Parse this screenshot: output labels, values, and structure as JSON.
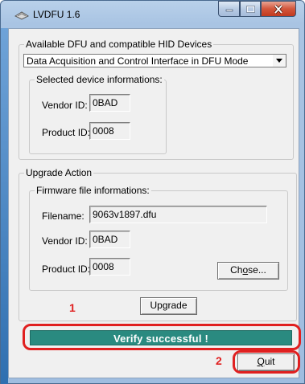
{
  "window": {
    "title": "LVDFU 1.6",
    "icon": "lvdfu-app-icon",
    "controls": {
      "minimize": "minimize-icon",
      "maximize": "maximize-icon",
      "close": "close-icon"
    }
  },
  "devices": {
    "legend": "Available DFU and compatible HID Devices",
    "selected": "Data Acquisition and Control Interface in DFU Mode",
    "dropdown_icon": "chevron-down-icon",
    "info": {
      "legend": "Selected device informations:",
      "vendor_label": "Vendor ID:",
      "vendor_value": "0BAD",
      "product_label": "Product ID:",
      "product_value": "0008"
    }
  },
  "upgrade": {
    "legend": "Upgrade Action",
    "firmware": {
      "legend": "Firmware file informations:",
      "filename_label": "Filename:",
      "filename_value": "9063v1897.dfu",
      "vendor_label": "Vendor ID:",
      "vendor_value": "0BAD",
      "product_label": "Product ID:",
      "product_value": "0008",
      "choose_label": "Choose...",
      "choose_prefix": "Ch",
      "choose_mnemonic": "o",
      "choose_suffix": "se..."
    },
    "upgrade_button": "Upgrade"
  },
  "status": {
    "text": "Verify successful !",
    "color": "#2a8a80"
  },
  "quit": {
    "label": "Quit",
    "mnemonic": "Q",
    "rest": "uit"
  },
  "annotations": {
    "marker_1": "1",
    "marker_2": "2",
    "color": "#e02020"
  }
}
